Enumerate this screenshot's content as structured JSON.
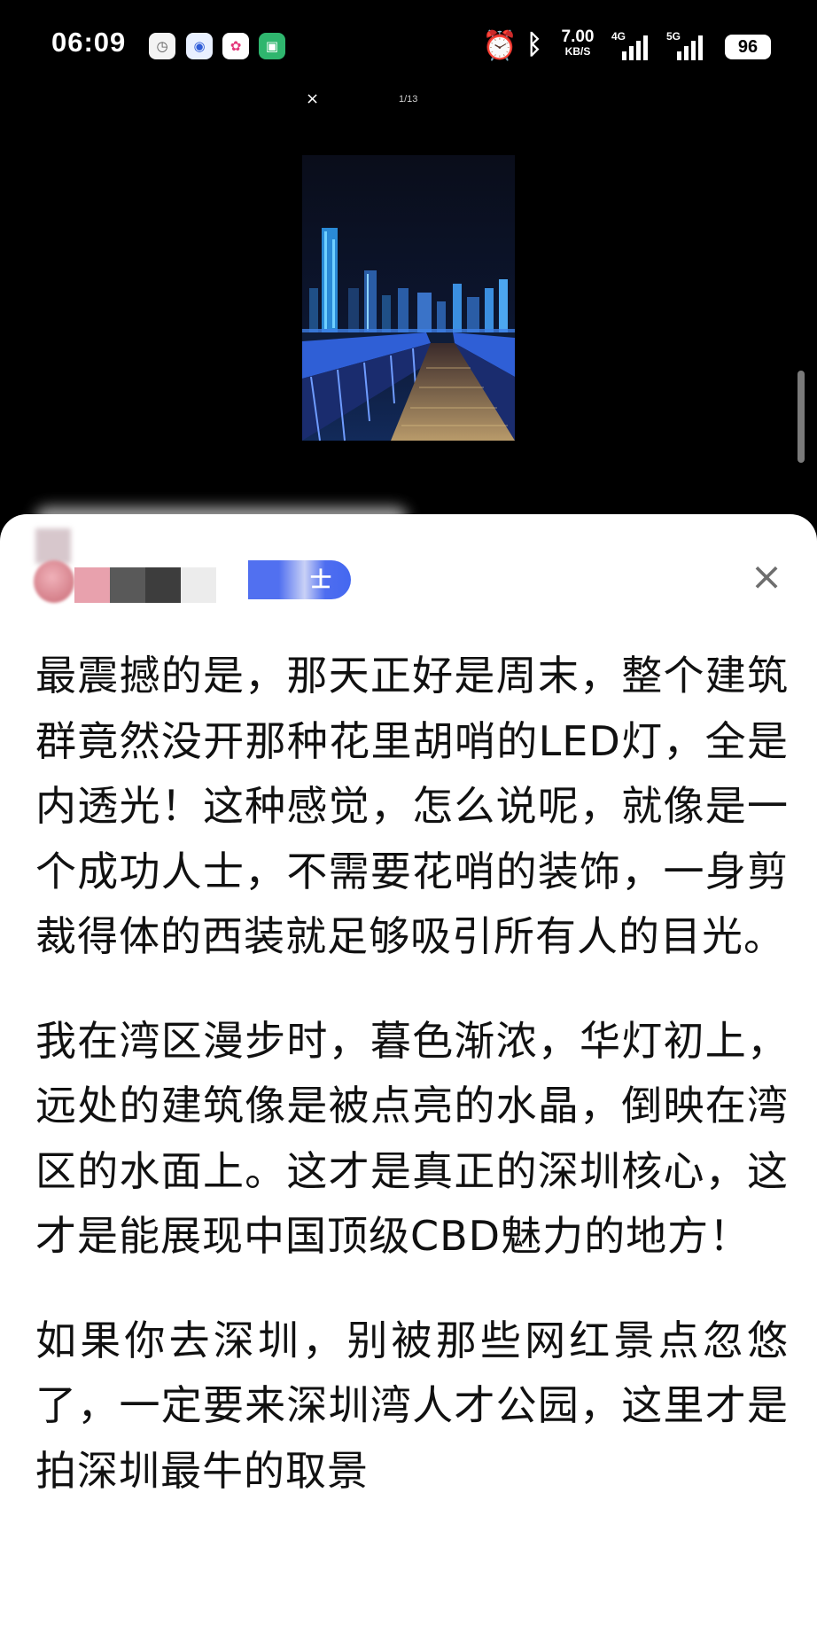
{
  "status_bar": {
    "time": "06:09",
    "apps": [
      "clock-app",
      "baidu-app",
      "photo-app",
      "green-app"
    ],
    "net_speed_value": "7.00",
    "net_speed_unit": "KB/S",
    "signal_1": "4G",
    "signal_2": "5G",
    "battery": "96"
  },
  "viewer": {
    "close_icon": "×",
    "counter": "1/13"
  },
  "sheet": {
    "tag_label": "士",
    "close_icon": "×"
  },
  "article": {
    "paragraphs": [
      "最震撼的是，那天正好是周末，整个建筑群竟然没开那种花里胡哨的LED灯，全是内透光！这种感觉，怎么说呢，就像是一个成功人士，不需要花哨的装饰，一身剪裁得体的西装就足够吸引所有人的目光。",
      "我在湾区漫步时，暮色渐浓，华灯初上，远处的建筑像是被点亮的水晶，倒映在湾区的水面上。这才是真正的深圳核心，这才是能展现中国顶级CBD魅力的地方！",
      "如果你去深圳，别被那些网红景点忽悠了，一定要来深圳湾人才公园，这里才是拍深圳最牛的取景"
    ]
  },
  "colors": {
    "tag_blue": "#5170f0",
    "sheet_bg": "#ffffff",
    "text": "#111111"
  }
}
